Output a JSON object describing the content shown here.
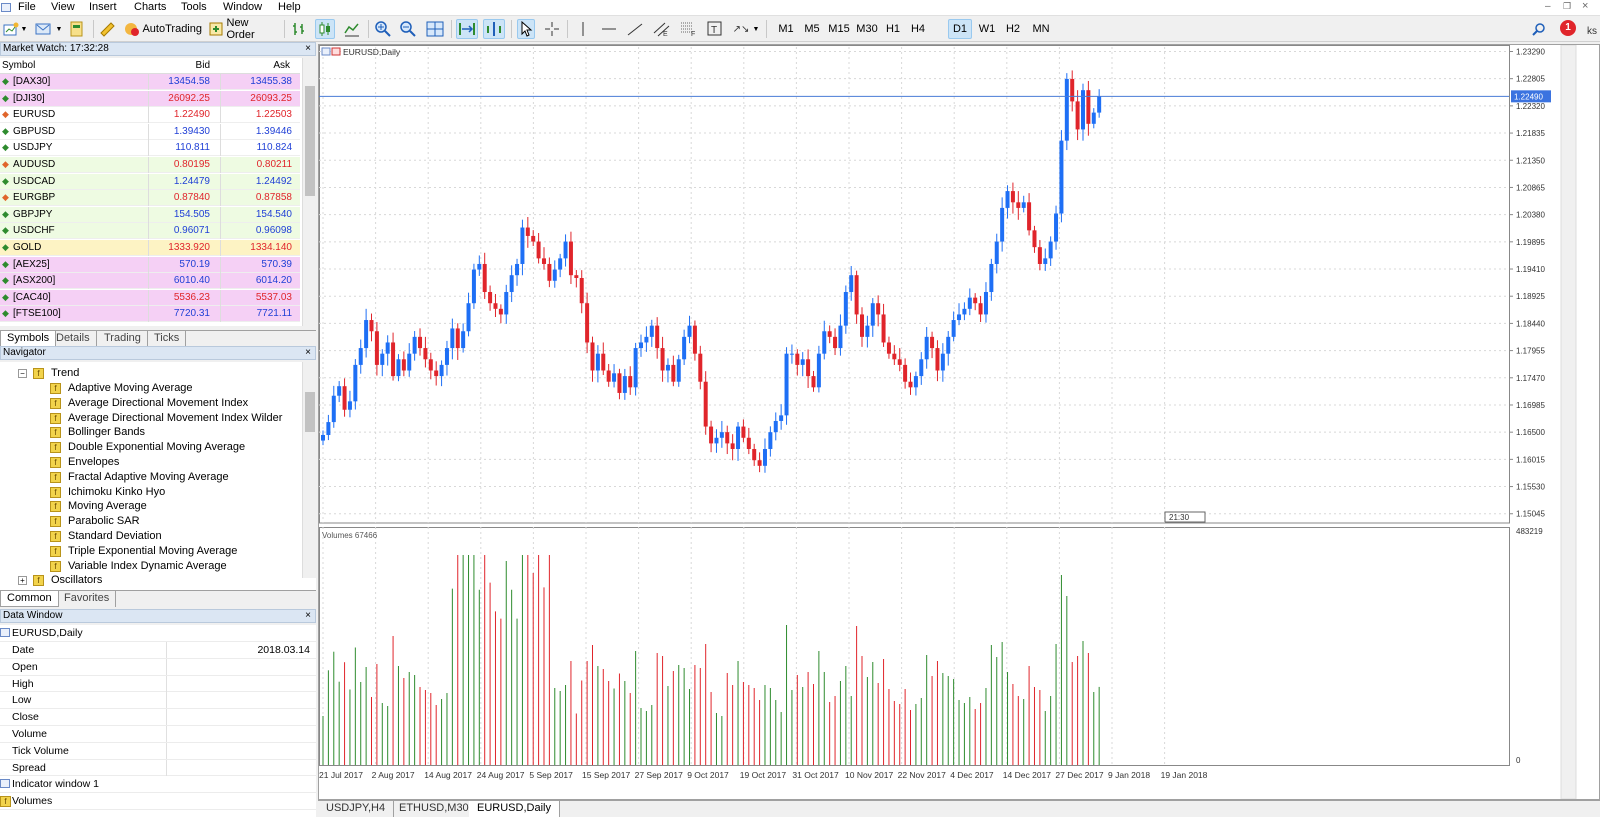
{
  "menu": [
    "File",
    "View",
    "Insert",
    "Charts",
    "Tools",
    "Window",
    "Help"
  ],
  "toolbar": {
    "autotrading_label": "AutoTrading",
    "neworder_label": "New Order",
    "timeframes": [
      "M1",
      "M5",
      "M15",
      "M30",
      "H1",
      "H4",
      "D1",
      "W1",
      "H2",
      "MN"
    ],
    "active_timeframe": "D1",
    "notification_count": "1",
    "edge_text": "ks"
  },
  "market_watch": {
    "title": "Market Watch: 17:32:28",
    "headers": {
      "symbol": "Symbol",
      "bid": "Bid",
      "ask": "Ask"
    },
    "rows": [
      {
        "symbol": "[DAX30]",
        "bid": "13454.58",
        "ask": "13455.38",
        "color": "#f5d0f5",
        "dir": "up",
        "price_color": "blue"
      },
      {
        "symbol": "[DJI30]",
        "bid": "26092.25",
        "ask": "26093.25",
        "color": "#f5d0f5",
        "dir": "up",
        "price_color": "red"
      },
      {
        "symbol": "EURUSD",
        "bid": "1.22490",
        "ask": "1.22503",
        "color": "#ffffff",
        "dir": "down",
        "price_color": "red"
      },
      {
        "symbol": "GBPUSD",
        "bid": "1.39430",
        "ask": "1.39446",
        "color": "#ffffff",
        "dir": "up",
        "price_color": "blue"
      },
      {
        "symbol": "USDJPY",
        "bid": "110.811",
        "ask": "110.824",
        "color": "#ffffff",
        "dir": "up",
        "price_color": "blue"
      },
      {
        "symbol": "AUDUSD",
        "bid": "0.80195",
        "ask": "0.80211",
        "color": "#eefbe2",
        "dir": "down",
        "price_color": "red"
      },
      {
        "symbol": "USDCAD",
        "bid": "1.24479",
        "ask": "1.24492",
        "color": "#eefbe2",
        "dir": "up",
        "price_color": "blue"
      },
      {
        "symbol": "EURGBP",
        "bid": "0.87840",
        "ask": "0.87858",
        "color": "#eefbe2",
        "dir": "down",
        "price_color": "red"
      },
      {
        "symbol": "GBPJPY",
        "bid": "154.505",
        "ask": "154.540",
        "color": "#eefbe2",
        "dir": "up",
        "price_color": "blue"
      },
      {
        "symbol": "USDCHF",
        "bid": "0.96071",
        "ask": "0.96098",
        "color": "#eefbe2",
        "dir": "up",
        "price_color": "blue"
      },
      {
        "symbol": "GOLD",
        "bid": "1333.920",
        "ask": "1334.140",
        "color": "#fdf3c4",
        "dir": "up",
        "price_color": "red"
      },
      {
        "symbol": "[AEX25]",
        "bid": "570.19",
        "ask": "570.39",
        "color": "#f5d0f5",
        "dir": "up",
        "price_color": "blue"
      },
      {
        "symbol": "[ASX200]",
        "bid": "6010.40",
        "ask": "6014.20",
        "color": "#f5d0f5",
        "dir": "up",
        "price_color": "blue"
      },
      {
        "symbol": "[CAC40]",
        "bid": "5536.23",
        "ask": "5537.03",
        "color": "#f5d0f5",
        "dir": "up",
        "price_color": "red"
      },
      {
        "symbol": "[FTSE100]",
        "bid": "7720.31",
        "ask": "7721.11",
        "color": "#f5d0f5",
        "dir": "up",
        "price_color": "blue"
      }
    ],
    "tabs": [
      "Symbols",
      "Details",
      "Trading",
      "Ticks"
    ]
  },
  "navigator": {
    "title": "Navigator",
    "group": "Trend",
    "items": [
      "Adaptive Moving Average",
      "Average Directional Movement Index",
      "Average Directional Movement Index Wilder",
      "Bollinger Bands",
      "Double Exponential Moving Average",
      "Envelopes",
      "Fractal Adaptive Moving Average",
      "Ichimoku Kinko Hyo",
      "Moving Average",
      "Parabolic SAR",
      "Standard Deviation",
      "Triple Exponential Moving Average",
      "Variable Index Dynamic Average"
    ],
    "next_group": "Oscillators",
    "tabs": [
      "Common",
      "Favorites"
    ]
  },
  "data_window": {
    "title": "Data Window",
    "symbol": "EURUSD,Daily",
    "rows": [
      {
        "k": "Date",
        "v": "2018.03.14"
      },
      {
        "k": "Open",
        "v": ""
      },
      {
        "k": "High",
        "v": ""
      },
      {
        "k": "Low",
        "v": ""
      },
      {
        "k": "Close",
        "v": ""
      },
      {
        "k": "Volume",
        "v": ""
      },
      {
        "k": "Tick Volume",
        "v": ""
      },
      {
        "k": "Spread",
        "v": ""
      }
    ],
    "extra": [
      "Indicator window 1",
      "Volumes"
    ]
  },
  "chart": {
    "title": "EURUSD,Daily",
    "volumes_label": "Volumes 67466",
    "current_price": "1.22490",
    "vol_max_label": "483219",
    "vol_zero_label": "0",
    "time_marker": "21:30",
    "up_color": "#1e6ff5",
    "down_color": "#e0252b",
    "vol_up_color": "#2e8b2e",
    "vol_down_color": "#e0252b",
    "price_line_color": "#4a7bd6"
  },
  "chart_data": {
    "type": "candlestick",
    "title": "EURUSD,Daily",
    "y_ticks": [
      "1.23290",
      "1.22805",
      "1.22320",
      "1.21835",
      "1.21350",
      "1.20865",
      "1.20380",
      "1.19895",
      "1.19410",
      "1.18925",
      "1.18440",
      "1.17955",
      "1.17470",
      "1.16985",
      "1.16500",
      "1.16015",
      "1.15530",
      "1.15045"
    ],
    "ylim": [
      1.1488,
      1.2337
    ],
    "x_labels": [
      "21 Jul 2017",
      "2 Aug 2017",
      "14 Aug 2017",
      "24 Aug 2017",
      "5 Sep 2017",
      "15 Sep 2017",
      "27 Sep 2017",
      "9 Oct 2017",
      "19 Oct 2017",
      "31 Oct 2017",
      "10 Nov 2017",
      "22 Nov 2017",
      "4 Dec 2017",
      "14 Dec 2017",
      "27 Dec 2017",
      "9 Jan 2018",
      "19 Jan 2018"
    ],
    "closes": [
      1.1645,
      1.1668,
      1.1715,
      1.1732,
      1.169,
      1.1705,
      1.177,
      1.18,
      1.185,
      1.183,
      1.177,
      1.179,
      1.181,
      1.175,
      1.178,
      1.176,
      1.179,
      1.182,
      1.18,
      1.178,
      1.176,
      1.175,
      1.177,
      1.18,
      1.1835,
      1.18,
      1.183,
      1.188,
      1.194,
      1.195,
      1.19,
      1.188,
      1.187,
      1.186,
      1.19,
      1.193,
      1.195,
      1.2015,
      1.2,
      1.199,
      1.196,
      1.195,
      1.192,
      1.194,
      1.196,
      1.199,
      1.193,
      1.1925,
      1.188,
      1.181,
      1.176,
      1.179,
      1.176,
      1.174,
      1.1755,
      1.172,
      1.175,
      1.173,
      1.18,
      1.181,
      1.182,
      1.184,
      1.18,
      1.176,
      1.177,
      1.174,
      1.178,
      1.182,
      1.184,
      1.179,
      1.174,
      1.166,
      1.163,
      1.164,
      1.165,
      1.163,
      1.162,
      1.166,
      1.164,
      1.162,
      1.16,
      1.159,
      1.162,
      1.165,
      1.167,
      1.168,
      1.179,
      1.179,
      1.177,
      1.178,
      1.175,
      1.173,
      1.179,
      1.183,
      1.182,
      1.18,
      1.184,
      1.19,
      1.193,
      1.186,
      1.182,
      1.184,
      1.188,
      1.186,
      1.181,
      1.179,
      1.178,
      1.177,
      1.174,
      1.173,
      1.175,
      1.178,
      1.182,
      1.18,
      1.176,
      1.179,
      1.182,
      1.185,
      1.186,
      1.187,
      1.189,
      1.188,
      1.186,
      1.19,
      1.195,
      1.199,
      1.205,
      1.208,
      1.206,
      1.205,
      1.206,
      1.201,
      1.198,
      1.195,
      1.196,
      1.199,
      1.204,
      1.217,
      1.228,
      1.224,
      1.219,
      1.226,
      1.22,
      1.222,
      1.2249
    ]
  }
}
